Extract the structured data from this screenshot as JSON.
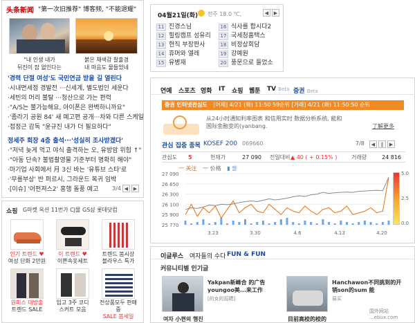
{
  "news": {
    "logo": "头条新闻",
    "headline": "\"第一次旧推荐\" 博客频, \"不能退耀\"",
    "photos": [
      {
        "caption_1": "\"내 인생 내가",
        "caption_2": "뒤진이 잡 없인다는"
      },
      {
        "caption_1": "붉은 채색감 찰출경",
        "caption_2": "내 마음도 물들었네"
      }
    ],
    "items": [
      "'경력 단절 여성'도 국민연금 받을 길 열린다",
      "·시내면세점 경발전 ···신세계, 별도법인 세운다",
      "·세빈의 머리 불탈 ···청산으로 가는 편력",
      "·\"A/S는 불가능해요, 아이폰은 완벽하니까요\"",
      "·'좀라기 공원 84' 새 예고편 공개···차와 다른 스케일",
      "·접정근 감독 \"윤규진 내가 더 필요하다\""
    ],
    "items2": [
      "정세주 회장 4층 출석···'성실히 조사받겠다'",
      "·\"저녁 늦게 먹고 야식 출격하는 오, 유방암 위험 ↑\"",
      "·\"아동 단속? 불법촬영물 기준부터 명확히 해야\"",
      "·마기업 사회에서 月 3신 바는 '유튜브 스타'로",
      "·'무를부상' 반 퍼르시, 그라운드 복귀 임박",
      "·[이슈] '어펀져스2' 홍행 돌풍 예고"
    ],
    "pager": "3/4"
  },
  "shopping": {
    "title": "쇼핑",
    "links": "G마켓 옥션 11번가 CJ몰 GS샵 롯데닷컴",
    "row1": [
      {
        "c1": "인기 트렌드 ♥",
        "c2": "여성 단화 2만원"
      },
      {
        "c1": "이 트렌드 ♥",
        "c2": "이쁜속옷세트"
      },
      {
        "c1": "트렌드 봄시상",
        "c2": "블라우스 특가"
      }
    ],
    "row2": [
      {
        "c1": "원피스 대방출",
        "c2": "트렌드 SALE"
      },
      {
        "c1": "입고 3주 코디",
        "c2": "스커트 모음"
      },
      {
        "c1": "전상품모두 판매중",
        "c2": "SALE 봄세일"
      }
    ]
  },
  "calendar": {
    "date": "04월21일(화)",
    "weather": "전주 18.0 ℃,",
    "left": [
      {
        "num": "11",
        "text": "진경스님"
      },
      {
        "num": "12",
        "text": "힐링캠프 성유리"
      },
      {
        "num": "13",
        "text": "현직 부장판사"
      },
      {
        "num": "14",
        "text": "휴머와 엘레"
      },
      {
        "num": "15",
        "text": "유병재"
      }
    ],
    "right": [
      {
        "num": "16",
        "text": "식사를 합시다2"
      },
      {
        "num": "17",
        "text": "국세청홈택스"
      },
      {
        "num": "18",
        "text": "비정상회담"
      },
      {
        "num": "19",
        "text": "강예원"
      },
      {
        "num": "20",
        "text": "풍문으로 들었소"
      }
    ]
  },
  "finance": {
    "tabs": [
      {
        "label": "연예",
        "beta": ""
      },
      {
        "label": "스포츠",
        "beta": ""
      },
      {
        "label": "영화",
        "beta": ""
      },
      {
        "label": "IT",
        "beta": ""
      },
      {
        "label": "쇼핑",
        "beta": ""
      },
      {
        "label": "웹툰",
        "beta": ""
      },
      {
        "label": "TV",
        "beta": "Beta"
      },
      {
        "label": "증권",
        "beta": "Beta"
      }
    ],
    "banner": "증권 인터넷관심도",
    "banner_detail": "[어제] 4/21 (화) 11:50 59순위  [거래] 4/21 (화) 11:50:50 순위",
    "tip": "从24小时通知利率图表 和信用实时 数据分析系统, 能和国际金融变的(yanbang.",
    "more": "了解更多",
    "stock_title": "관심 집중 종목",
    "stock_name": "KOSEF 200",
    "stock_code": "069660",
    "pager": "7/8",
    "table": {
      "h1": "관심도",
      "v1": "5",
      "h2": "현재가",
      "v2": "27 090",
      "h3": "전일대비",
      "v3": "▲ 40  ( + 0.15% )",
      "h4": "거래량",
      "v4": "24 816"
    },
    "legend": [
      "一 关注",
      "一 价格",
      "▮ 쌀"
    ],
    "scale": [
      "5.0",
      "2.5",
      "0.0"
    ]
  },
  "chart_data": {
    "type": "line",
    "x_ticks": [
      "3.23",
      "3.30",
      "4.6",
      "4.13",
      "4.20"
    ],
    "ylabels": [
      "27 090",
      "26 650",
      "26 300",
      "26 100",
      "25 900",
      "25 770"
    ],
    "ylim": [
      25700,
      27200
    ],
    "price_series": [
      26150,
      26200,
      26180,
      26220,
      26280,
      26260,
      26300,
      26290,
      26310,
      26350,
      26380,
      26400,
      26380,
      26420,
      26460,
      26430,
      26450,
      26480,
      26520,
      26550,
      26530,
      26580,
      26600,
      26650,
      26620,
      26640,
      26650,
      26660,
      26650,
      26680,
      26690,
      26700,
      26710,
      26700,
      27090
    ],
    "interest_series": [
      26000,
      26300,
      25950,
      26200,
      26050,
      26250,
      25900,
      26150,
      26400,
      26050,
      26200,
      26300,
      26100,
      26050,
      26300,
      26150,
      26000,
      26200,
      26100,
      26050,
      26250,
      26100,
      26000,
      26150,
      26200,
      26050,
      26100,
      26250,
      26000,
      26050,
      26100,
      26200,
      26050,
      26100,
      27090
    ],
    "volume": [
      3,
      1,
      2,
      4,
      1,
      2,
      5,
      1,
      3,
      2,
      4,
      1,
      2,
      3,
      1,
      2,
      4,
      5,
      2,
      1,
      3,
      2,
      1,
      4,
      2,
      1,
      3,
      2,
      1,
      2,
      3,
      2,
      1,
      2,
      3
    ]
  },
  "bottom": {
    "tabs": [
      "이글루스",
      "여자들의 수다",
      "FUN & FUN"
    ],
    "community": "커뮤니티별 인기글",
    "post1": "Yakpan新峰合 的广告 youngoo美...来工作",
    "post1_src": "[的女的招聘]",
    "post2": "Hanchawon不同挑到的开销son的sum 能",
    "post2_src": "易买",
    "caption1": "여자 小편의 행진",
    "caption2": "目前高校的校的",
    "watermark": "国外网站",
    "watermark_url": "...ebux.com"
  },
  "colors": {
    "accent": "#1a4aa0",
    "red": "#e33",
    "orange": "#ef6c00"
  }
}
